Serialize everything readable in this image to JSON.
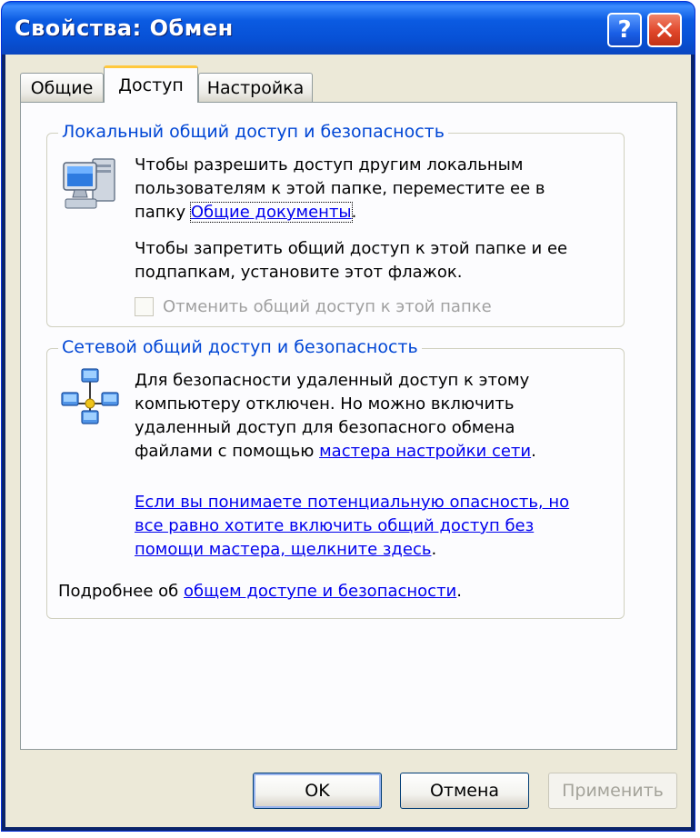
{
  "window": {
    "title": "Свойства: Обмен",
    "help_label": "?",
    "close_label": "✕"
  },
  "tabs": [
    {
      "label": "Общие",
      "active": false
    },
    {
      "label": "Доступ",
      "active": true
    },
    {
      "label": "Настройка",
      "active": false
    }
  ],
  "local_group": {
    "title": "Локальный общий доступ и безопасность",
    "text1_line1": "Чтобы разрешить доступ другим локальным",
    "text1_line2": "пользователям к этой папке, переместите ее в",
    "text1_line3_prefix": "папку ",
    "shared_docs_link": "Общие документы",
    "text1_suffix": ".",
    "text2_line1": "Чтобы запретить общий доступ к этой папке и ее",
    "text2_line2": "подпапкам, установите этот флажок.",
    "checkbox_label": "Отменить общий доступ к этой папке",
    "checkbox_checked": false,
    "icon": "computer-icon"
  },
  "network_group": {
    "title": "Сетевой общий доступ и безопасность",
    "text1_line1": "Для безопасности удаленный доступ к этому",
    "text1_line2": "компьютеру отключен. Но можно включить",
    "text1_line3": "удаленный доступ для безопасного обмена",
    "text1_line4_prefix": "файлами с помощью ",
    "wizard_link": "мастера настройки сети",
    "text1_suffix": ".",
    "risk_link_line1": "Если вы понимаете потенциальную опасность, но",
    "risk_link_line2": "все равно хотите включить общий доступ без",
    "risk_link_line3": "помощи мастера, щелкните здесь",
    "risk_suffix": ".",
    "more_prefix": "Подробнее об ",
    "more_link": "общем доступе и безопасности",
    "more_suffix": ".",
    "icon": "network-icon"
  },
  "buttons": {
    "ok": "OK",
    "cancel": "Отмена",
    "apply": "Применить"
  },
  "colors": {
    "titlebar": "#0a5ce8",
    "group_title": "#0046d5",
    "link": "#0000ee",
    "dialog_bg": "#ece9d8"
  }
}
